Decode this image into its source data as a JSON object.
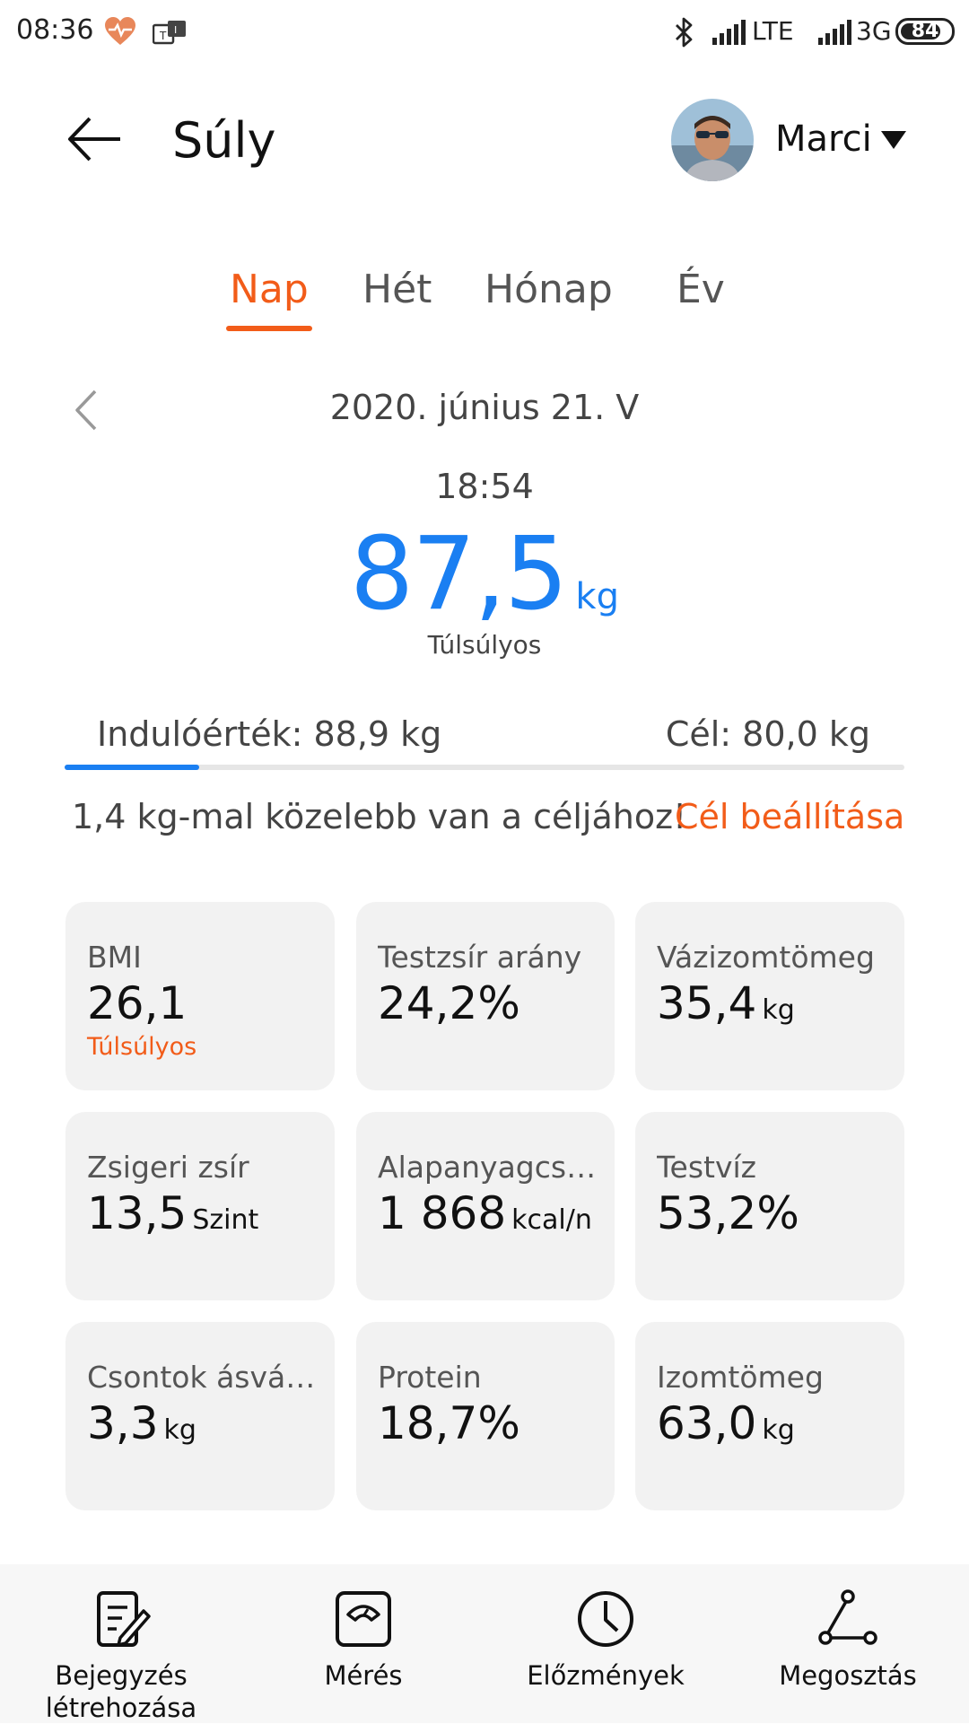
{
  "status_bar": {
    "time": "08:36",
    "network_label": "LTE",
    "network2_label": "3G",
    "battery": "84",
    "battery_level": 0.84,
    "heart_color": "#e8875a"
  },
  "header": {
    "title": "Súly",
    "user_name": "Marci"
  },
  "tabs": [
    {
      "label": "Nap",
      "active": true
    },
    {
      "label": "Hét",
      "active": false
    },
    {
      "label": "Hónap",
      "active": false
    },
    {
      "label": "Év",
      "active": false
    }
  ],
  "date": "2020. június 21. V",
  "time": "18:54",
  "weight": {
    "value": "87,5",
    "unit": "kg",
    "status": "Túlsúlyos"
  },
  "progress": {
    "start_label": "Indulóérték: 88,9 kg",
    "goal_label": "Cél: 80,0 kg",
    "fraction": 0.16,
    "closer_text": "1,4 kg-mal közelebb van a céljához!",
    "set_goal_label": "Cél beállítása"
  },
  "metrics": [
    {
      "label": "BMI",
      "value": "26,1",
      "unit": "",
      "status": "Túlsúlyos"
    },
    {
      "label": "Testzsír arány",
      "value": "24,2%",
      "unit": "",
      "status": ""
    },
    {
      "label": "Vázizomtömeg",
      "value": "35,4",
      "unit": "kg",
      "status": ""
    },
    {
      "label": "Zsigeri zsír",
      "value": "13,5",
      "unit": "Szint",
      "status": ""
    },
    {
      "label": "Alapanyagcs…",
      "value": "1 868",
      "unit": "kcal/n",
      "status": ""
    },
    {
      "label": "Testvíz",
      "value": "53,2%",
      "unit": "",
      "status": ""
    },
    {
      "label": "Csontok ásvá…",
      "value": "3,3",
      "unit": "kg",
      "status": ""
    },
    {
      "label": "Protein",
      "value": "18,7%",
      "unit": "",
      "status": ""
    },
    {
      "label": "Izomtömeg",
      "value": "63,0",
      "unit": "kg",
      "status": ""
    }
  ],
  "bottom_nav": [
    {
      "label": "Bejegyzés létrehozása",
      "icon": "edit-note-icon"
    },
    {
      "label": "Mérés",
      "icon": "scale-icon"
    },
    {
      "label": "Előzmények",
      "icon": "clock-icon"
    },
    {
      "label": "Megosztás",
      "icon": "share-icon"
    }
  ],
  "colors": {
    "accent": "#f25c19",
    "value_blue": "#1a7ff2"
  }
}
